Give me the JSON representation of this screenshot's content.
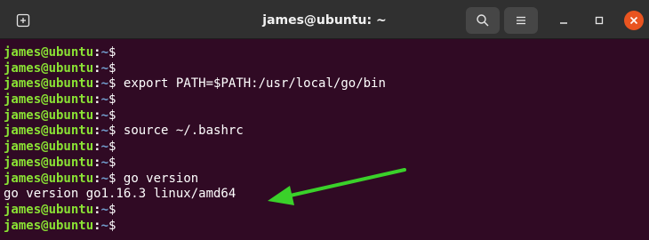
{
  "window": {
    "title": "james@ubuntu: ~",
    "accent_color": "#e95420",
    "background_color": "#300a24"
  },
  "titlebar": {
    "new_tab_icon": "new-tab-icon",
    "search_icon": "search-icon",
    "menu_icon": "hamburger-menu-icon",
    "minimize_icon": "minimize-icon",
    "maximize_icon": "maximize-icon",
    "close_icon": "close-icon"
  },
  "prompt": {
    "user_host": "james@ubuntu",
    "separator": ":",
    "path": "~",
    "symbol": "$",
    "user_color": "#8ae234",
    "path_color": "#729fcf"
  },
  "lines": [
    {
      "type": "prompt",
      "command": ""
    },
    {
      "type": "prompt",
      "command": ""
    },
    {
      "type": "prompt",
      "command": " export PATH=$PATH:/usr/local/go/bin"
    },
    {
      "type": "prompt",
      "command": ""
    },
    {
      "type": "prompt",
      "command": ""
    },
    {
      "type": "prompt",
      "command": " source ~/.bashrc"
    },
    {
      "type": "prompt",
      "command": ""
    },
    {
      "type": "prompt",
      "command": ""
    },
    {
      "type": "prompt",
      "command": " go version"
    },
    {
      "type": "output",
      "text": "go version go1.16.3 linux/amd64"
    },
    {
      "type": "prompt",
      "command": ""
    },
    {
      "type": "prompt",
      "command": ""
    }
  ],
  "annotation": {
    "arrow_icon": "green-arrow-icon",
    "arrow_color": "#3ad12a"
  }
}
